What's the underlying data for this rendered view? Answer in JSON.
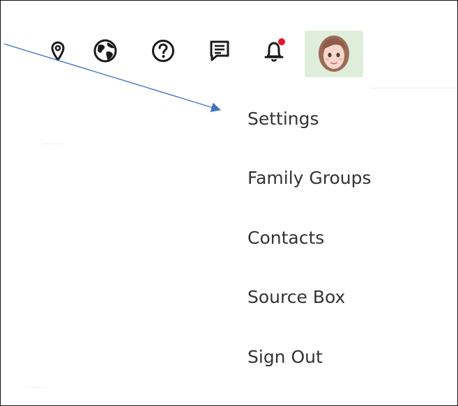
{
  "toolbar": {
    "icons": [
      {
        "name": "location-pin-icon"
      },
      {
        "name": "globe-icon"
      },
      {
        "name": "help-icon"
      },
      {
        "name": "messages-icon"
      },
      {
        "name": "notifications-bell-icon",
        "badge": true,
        "badge_color": "#e8102a"
      }
    ],
    "avatar_bg": "#dfeeda"
  },
  "user_menu": {
    "items": [
      {
        "label": "Settings"
      },
      {
        "label": "Family Groups"
      },
      {
        "label": "Contacts"
      },
      {
        "label": "Source Box"
      },
      {
        "label": "Sign Out"
      }
    ]
  },
  "annotation": {
    "arrow_color": "#4472c4"
  }
}
